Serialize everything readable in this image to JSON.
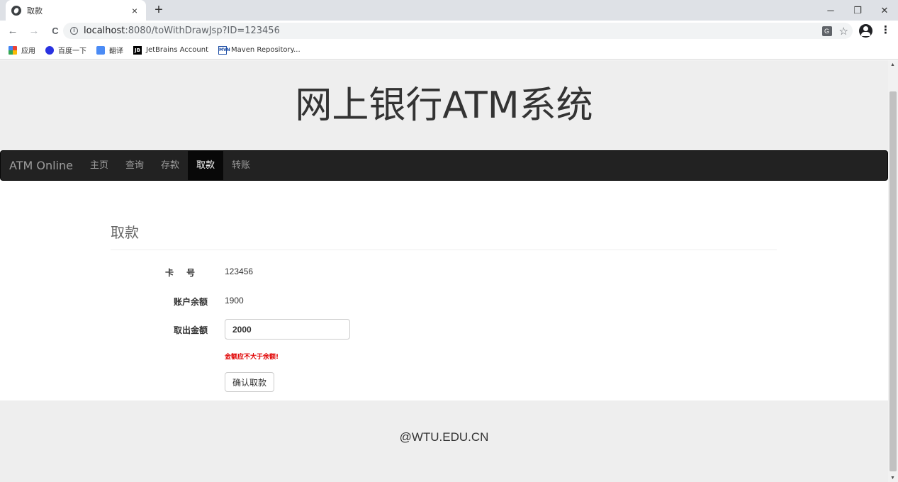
{
  "browser": {
    "tab_title": "取款",
    "tab_close": "×",
    "new_tab": "+",
    "url_host": "localhost",
    "url_path": ":8080/toWithDrawJsp?ID=123456",
    "window_controls": {
      "minimize": "─",
      "restore": "❐",
      "close": "✕"
    },
    "nav": {
      "back": "←",
      "forward": "→",
      "reload": "C"
    }
  },
  "bookmarks": [
    {
      "label": "应用",
      "icon": "apps-icon"
    },
    {
      "label": "百度一下",
      "icon": "baidu-icon"
    },
    {
      "label": "翻译",
      "icon": "translate-bookmark-icon"
    },
    {
      "label": "JetBrains Account",
      "icon": "jetbrains-icon"
    },
    {
      "label": "Maven Repository...",
      "icon": "maven-icon"
    }
  ],
  "site": {
    "title": "网上银行ATM系统",
    "brand": "ATM Online",
    "nav_items": [
      "主页",
      "查询",
      "存款",
      "取款",
      "转账"
    ],
    "active_nav": "取款"
  },
  "withdraw": {
    "heading": "取款",
    "card_label": "卡号",
    "card_number": "123456",
    "balance_label": "账户余额",
    "balance": "1900",
    "amount_label": "取出金额",
    "amount_value": "2000",
    "error": "金额应不大于余额!",
    "submit_label": "确认取款"
  },
  "footer": {
    "text": "@WTU.EDU.CN"
  }
}
